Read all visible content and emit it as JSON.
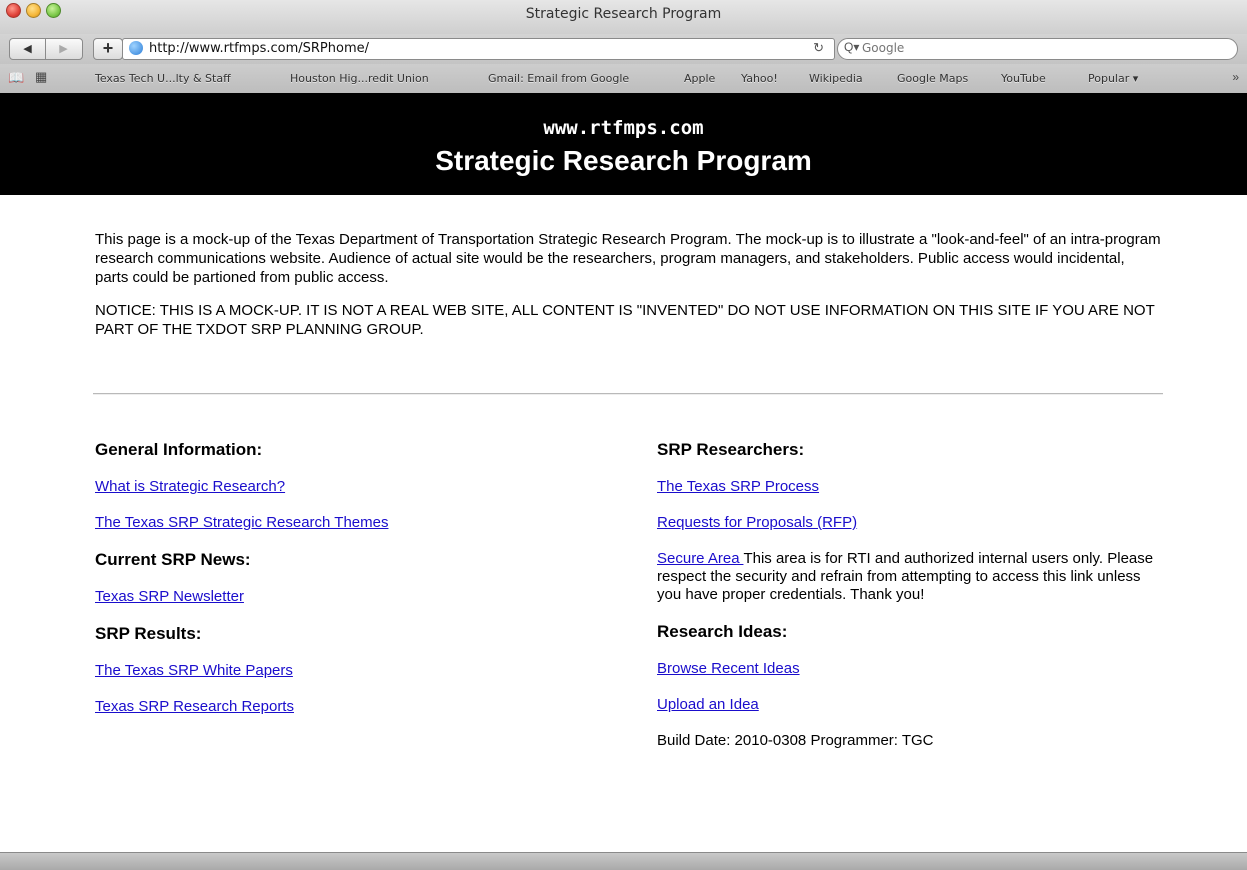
{
  "window": {
    "title": "Strategic Research Program"
  },
  "toolbar": {
    "back_icon": "◀",
    "forward_icon": "▶",
    "add_icon": "+",
    "url": "http://www.rtfmps.com/SRPhome/",
    "reload_icon": "↻",
    "search_placeholder": "Google",
    "search_icon": "Q▾"
  },
  "bookmarks": {
    "items": [
      "Texas Tech U...lty & Staff",
      "Houston Hig...redit Union",
      "Gmail: Email from Google",
      "Apple",
      "Yahoo!",
      "Wikipedia",
      "Google Maps",
      "YouTube",
      "Popular ▾"
    ],
    "more_icon": "»"
  },
  "banner": {
    "url": "www.rtfmps.com",
    "title": "Strategic Research Program"
  },
  "intro": {
    "paragraph": "This page is a mock-up of the Texas Department of Transportation Strategic Research Program. The mock-up is to illustrate a \"look-and-feel\" of an intra-program research communications website. Audience of actual site would be the researchers, program managers, and stakeholders. Public access would incidental, parts could be partioned from public access.",
    "notice": "NOTICE: THIS IS A MOCK-UP. IT IS NOT A REAL WEB SITE, ALL CONTENT IS \"INVENTED\" DO NOT USE INFORMATION ON THIS SITE IF YOU ARE NOT PART OF THE TXDOT SRP PLANNING GROUP."
  },
  "left": {
    "general_heading": "General Information:",
    "general_links": [
      "What is Strategic Research?",
      "The Texas SRP Strategic Research Themes"
    ],
    "news_heading": "Current SRP News:",
    "news_links": [
      "Texas SRP Newsletter"
    ],
    "results_heading": "SRP Results:",
    "results_links": [
      "The Texas SRP White Papers",
      "Texas SRP Research Reports"
    ]
  },
  "right": {
    "researchers_heading": "SRP Researchers:",
    "researchers_links": [
      "The Texas SRP Process",
      "Requests for Proposals (RFP)"
    ],
    "secure_link": "Secure Area ",
    "secure_text": "This area is for RTI and authorized internal users only. Please respect the security and refrain from attempting to access this link unless you have proper credentials. Thank you!",
    "ideas_heading": "Research Ideas:",
    "ideas_links": [
      "Browse Recent Ideas",
      "Upload an Idea"
    ],
    "build_info": "Build Date: 2010-0308 Programmer: TGC"
  }
}
